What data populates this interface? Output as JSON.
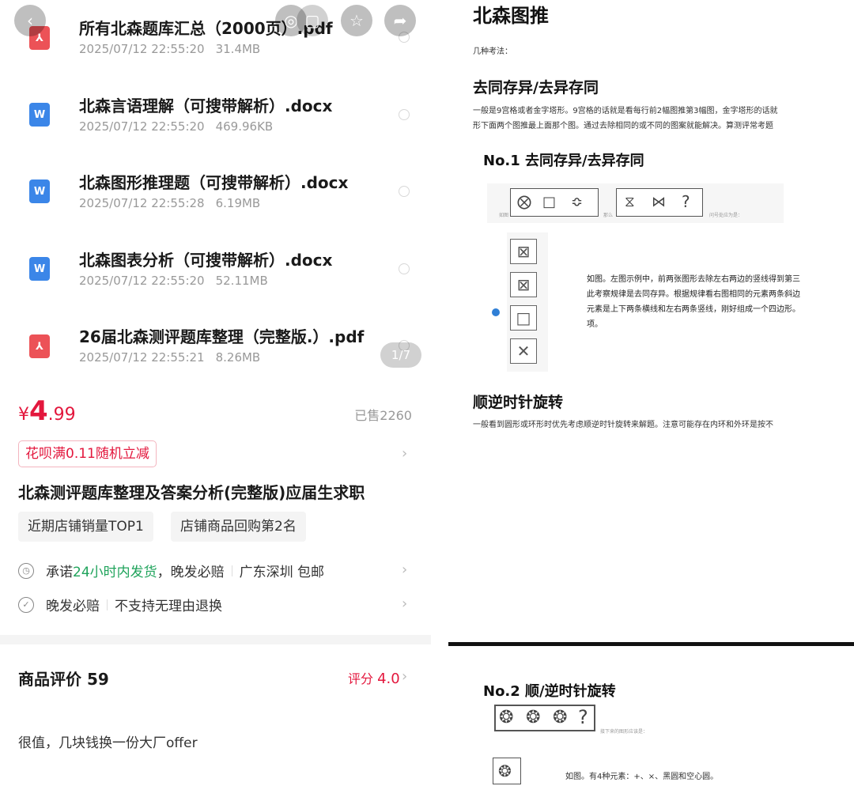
{
  "files": [
    {
      "name": "所有北森题库汇总（2000页）.pdf",
      "date": "2025/07/12 22:55:20",
      "size": "31.4MB",
      "type": "pdf"
    },
    {
      "name": "北森言语理解（可搜带解析）.docx",
      "date": "2025/07/12 22:55:20",
      "size": "469.96KB",
      "type": "doc"
    },
    {
      "name": "北森图形推理题（可搜带解析）.docx",
      "date": "2025/07/12 22:55:28",
      "size": "6.19MB",
      "type": "doc"
    },
    {
      "name": "北森图表分析（可搜带解析）.docx",
      "date": "2025/07/12 22:55:20",
      "size": "52.11MB",
      "type": "doc"
    },
    {
      "name": "26届北森测评题库整理（完整版.）.pdf",
      "date": "2025/07/12 22:55:21",
      "size": "8.26MB",
      "type": "pdf"
    }
  ],
  "icons": {
    "pdf": "pdf-icon",
    "doc": "word-icon",
    "back": "back-icon",
    "favorite": "star-icon",
    "share": "share-icon"
  },
  "page_indicator": "1/7",
  "price": {
    "currency": "¥",
    "integer": "4",
    "decimal": ".99"
  },
  "sold": "已售2260",
  "promo": "花呗满0.11随机立减",
  "title": "北森测评题库整理及答案分析(完整版)应届生求职",
  "tags": [
    "近期店铺销量TOP1",
    "店铺商品回购第2名"
  ],
  "service1": {
    "pre": "承诺",
    "highlight": "24小时内发货",
    "post": "，晚发必赔",
    "location": "广东深圳 包邮"
  },
  "service2": {
    "a": "晚发必赔",
    "b": "不支持无理由退换"
  },
  "reviews": {
    "title": "商品评价 59",
    "rating_label": "评分",
    "rating_value": "4.0",
    "first": "很值，几块钱换一份大厂offer"
  },
  "doc": {
    "h1": "北森图推",
    "intro": "几种考法：",
    "h2_1": "去同存异/去异存同",
    "body1_l1": "一般是9宫格或者金字塔形。9宫格的话就是看每行前2幅图推第3幅图，金字塔形的话就",
    "body1_l2": "形下面两个图推最上面那个图。通过去除相同的或不同的图案就能解决。算测评常考题",
    "sec1": "No.1  去同存异/去异存同",
    "q_label_a": "如图",
    "q_label_b": "那么",
    "q_label_c": "问号处应为是：",
    "question_mark": "?",
    "expl_l1": "如图。左图示例中，前两张图形去除左右两边的竖线得到第三",
    "expl_l2": "此考察规律是去同存异。根据规律看右图相同的元素两条斜边",
    "expl_l3": "元素是上下两条横线和左右两条竖线，刚好组成一个四边形。",
    "expl_l4": "项。",
    "h2_2": "顺逆时针旋转",
    "body2": "一般看到圆形或环形时优先考虑顺逆时针旋转来解题。注意可能存在内环和外环是按不",
    "sec2": "No.2  顺/逆时针旋转",
    "q2_label": "接下来的图形应该是：",
    "expl2": "如图。有4种元素：+、×、黑圆和空心圆。"
  }
}
